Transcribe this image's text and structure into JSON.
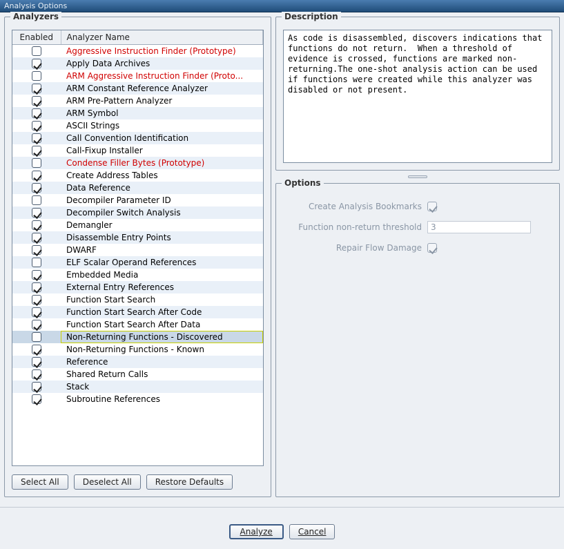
{
  "window": {
    "title": "Analysis Options"
  },
  "analyzers": {
    "panel_title": "Analyzers",
    "columns": {
      "enabled": "Enabled",
      "name": "Analyzer Name"
    },
    "rows": [
      {
        "enabled": false,
        "name": "Aggressive Instruction Finder (Prototype)",
        "proto": true
      },
      {
        "enabled": true,
        "name": "Apply Data Archives"
      },
      {
        "enabled": false,
        "name": "ARM Aggressive Instruction Finder (Proto...",
        "proto": true
      },
      {
        "enabled": true,
        "name": "ARM Constant Reference Analyzer"
      },
      {
        "enabled": true,
        "name": "ARM Pre-Pattern Analyzer"
      },
      {
        "enabled": true,
        "name": "ARM Symbol"
      },
      {
        "enabled": true,
        "name": "ASCII Strings"
      },
      {
        "enabled": true,
        "name": "Call Convention Identification"
      },
      {
        "enabled": true,
        "name": "Call-Fixup Installer"
      },
      {
        "enabled": false,
        "name": "Condense Filler Bytes (Prototype)",
        "proto": true
      },
      {
        "enabled": true,
        "name": "Create Address Tables"
      },
      {
        "enabled": true,
        "name": "Data Reference"
      },
      {
        "enabled": false,
        "name": "Decompiler Parameter ID"
      },
      {
        "enabled": true,
        "name": "Decompiler Switch Analysis"
      },
      {
        "enabled": true,
        "name": "Demangler"
      },
      {
        "enabled": true,
        "name": "Disassemble Entry Points"
      },
      {
        "enabled": true,
        "name": "DWARF"
      },
      {
        "enabled": false,
        "name": "ELF Scalar Operand References"
      },
      {
        "enabled": true,
        "name": "Embedded Media"
      },
      {
        "enabled": true,
        "name": "External Entry References"
      },
      {
        "enabled": true,
        "name": "Function Start Search"
      },
      {
        "enabled": true,
        "name": "Function Start Search After Code"
      },
      {
        "enabled": true,
        "name": "Function Start Search After Data"
      },
      {
        "enabled": false,
        "name": "Non-Returning Functions - Discovered",
        "selected": true
      },
      {
        "enabled": true,
        "name": "Non-Returning Functions - Known"
      },
      {
        "enabled": true,
        "name": "Reference"
      },
      {
        "enabled": true,
        "name": "Shared Return Calls"
      },
      {
        "enabled": true,
        "name": "Stack"
      },
      {
        "enabled": true,
        "name": "Subroutine References"
      }
    ],
    "buttons": {
      "select_all": "Select All",
      "deselect_all": "Deselect All",
      "restore_defaults": "Restore Defaults"
    }
  },
  "description": {
    "panel_title": "Description",
    "text": "As code is disassembled, discovers indications that functions do not return.  When a threshold of evidence is crossed, functions are marked non-returning.The one-shot analysis action can be used if functions were created while this analyzer was disabled or not present."
  },
  "options": {
    "panel_title": "Options",
    "items": {
      "create_bookmarks": {
        "label": "Create Analysis Bookmarks",
        "checked": true,
        "disabled": true
      },
      "nonreturn_threshold": {
        "label": "Function non-return threshold",
        "value": "3",
        "disabled": true
      },
      "repair_flow": {
        "label": "Repair Flow Damage",
        "checked": true,
        "disabled": true
      }
    }
  },
  "footer": {
    "analyze": "Analyze",
    "cancel": "Cancel"
  }
}
